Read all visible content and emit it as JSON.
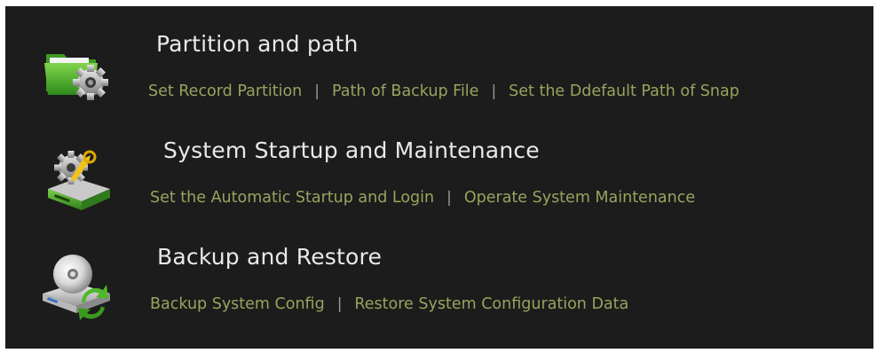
{
  "sections": [
    {
      "icon": "folder-gear-icon",
      "title": "Partition and path",
      "links": [
        "Set Record Partition",
        "Path of Backup File",
        "Set the Ddefault Path of Snap"
      ],
      "separator": "|"
    },
    {
      "icon": "maintenance-tools-icon",
      "title": "System Startup and Maintenance",
      "links": [
        "Set the Automatic Startup and Login",
        "Operate System Maintenance"
      ],
      "separator": "|"
    },
    {
      "icon": "backup-restore-icon",
      "title": "Backup and Restore",
      "links": [
        "Backup System Config",
        "Restore System Configuration Data"
      ],
      "separator": "|"
    }
  ],
  "colors": {
    "panel_background": "#1c1c1c",
    "title_text": "#e9e9e9",
    "link_text": "#97a45e",
    "separator": "#9a9a9a"
  }
}
